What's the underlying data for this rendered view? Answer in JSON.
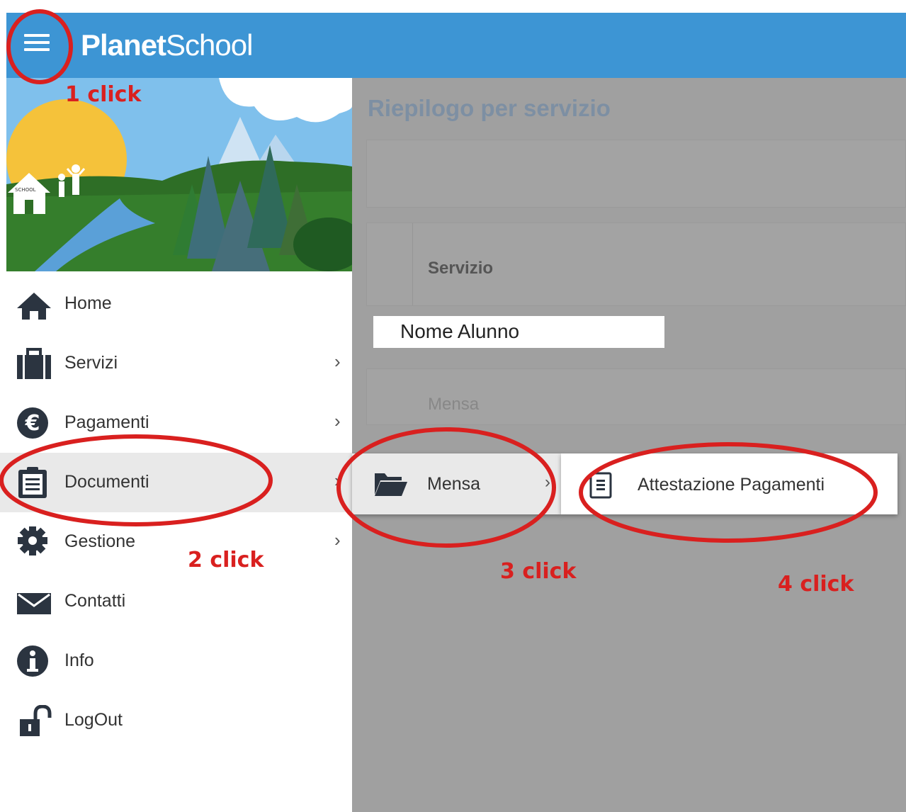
{
  "header": {
    "brand_bold": "Planet",
    "brand_light": "School",
    "background_color": "#3d95d4"
  },
  "main": {
    "title": "Riepilogo per servizio",
    "table_header": "Servizio",
    "student_name": "Nome Alunno",
    "row_service": "Mensa"
  },
  "sidebar": {
    "banner_school_sign": "SCHOOL",
    "items": [
      {
        "label": "Home",
        "icon": "home-icon",
        "has_submenu": false
      },
      {
        "label": "Servizi",
        "icon": "briefcase-icon",
        "has_submenu": true
      },
      {
        "label": "Pagamenti",
        "icon": "euro-icon",
        "has_submenu": true
      },
      {
        "label": "Documenti",
        "icon": "clipboard-icon",
        "has_submenu": true
      },
      {
        "label": "Gestione",
        "icon": "gear-icon",
        "has_submenu": true
      },
      {
        "label": "Contatti",
        "icon": "envelope-icon",
        "has_submenu": false
      },
      {
        "label": "Info",
        "icon": "info-icon",
        "has_submenu": false
      },
      {
        "label": "LogOut",
        "icon": "unlock-icon",
        "has_submenu": false
      }
    ]
  },
  "submenu": {
    "level1_label": "Mensa",
    "level1_icon": "folder-open-icon",
    "level2_label": "Attestazione Pagamenti",
    "level2_icon": "document-icon"
  },
  "annotations": {
    "step1": "1 click",
    "step2": "2 click",
    "step3": "3 click",
    "step4": "4 click",
    "color": "#d9201f"
  }
}
